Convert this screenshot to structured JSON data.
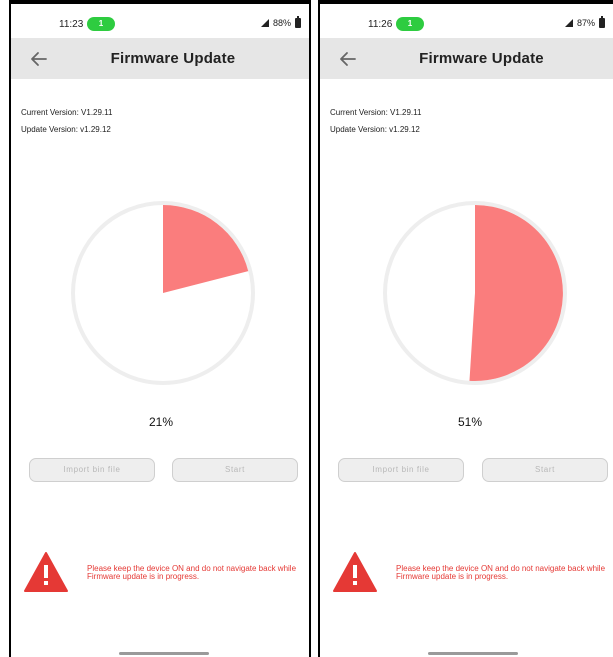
{
  "screens": [
    {
      "status": {
        "time": "11:23",
        "notif_badge": "1",
        "battery": "88%"
      },
      "app_bar": {
        "title": "Firmware Update"
      },
      "versions": {
        "current": "Current Version:  V1.29.11",
        "update": "Update Version: v1.29.12"
      },
      "progress": {
        "percent": 21,
        "label": "21%"
      },
      "buttons": {
        "import": "Import bin file",
        "start": "Start"
      },
      "warning": {
        "text": "Please keep the device ON and do not navigate back while Firmware update is in progress."
      }
    },
    {
      "status": {
        "time": "11:26",
        "notif_badge": "1",
        "battery": "87%"
      },
      "app_bar": {
        "title": "Firmware Update"
      },
      "versions": {
        "current": "Current Version:  V1.29.11",
        "update": "Update Version: v1.29.12"
      },
      "progress": {
        "percent": 51,
        "label": "51%"
      },
      "buttons": {
        "import": "Import bin file",
        "start": "Start"
      },
      "warning": {
        "text": "Please keep the device ON and do not navigate back while Firmware update is in progress."
      }
    }
  ],
  "colors": {
    "progress_fill": "#fa7d7d",
    "warning_red": "#e53935",
    "app_bar_bg": "#e6e6e6",
    "status_pill": "#2ecc40"
  },
  "icons": {
    "back": "arrow-left-icon",
    "warning": "warning-triangle-icon",
    "battery": "battery-icon",
    "signal": "signal-icon"
  }
}
